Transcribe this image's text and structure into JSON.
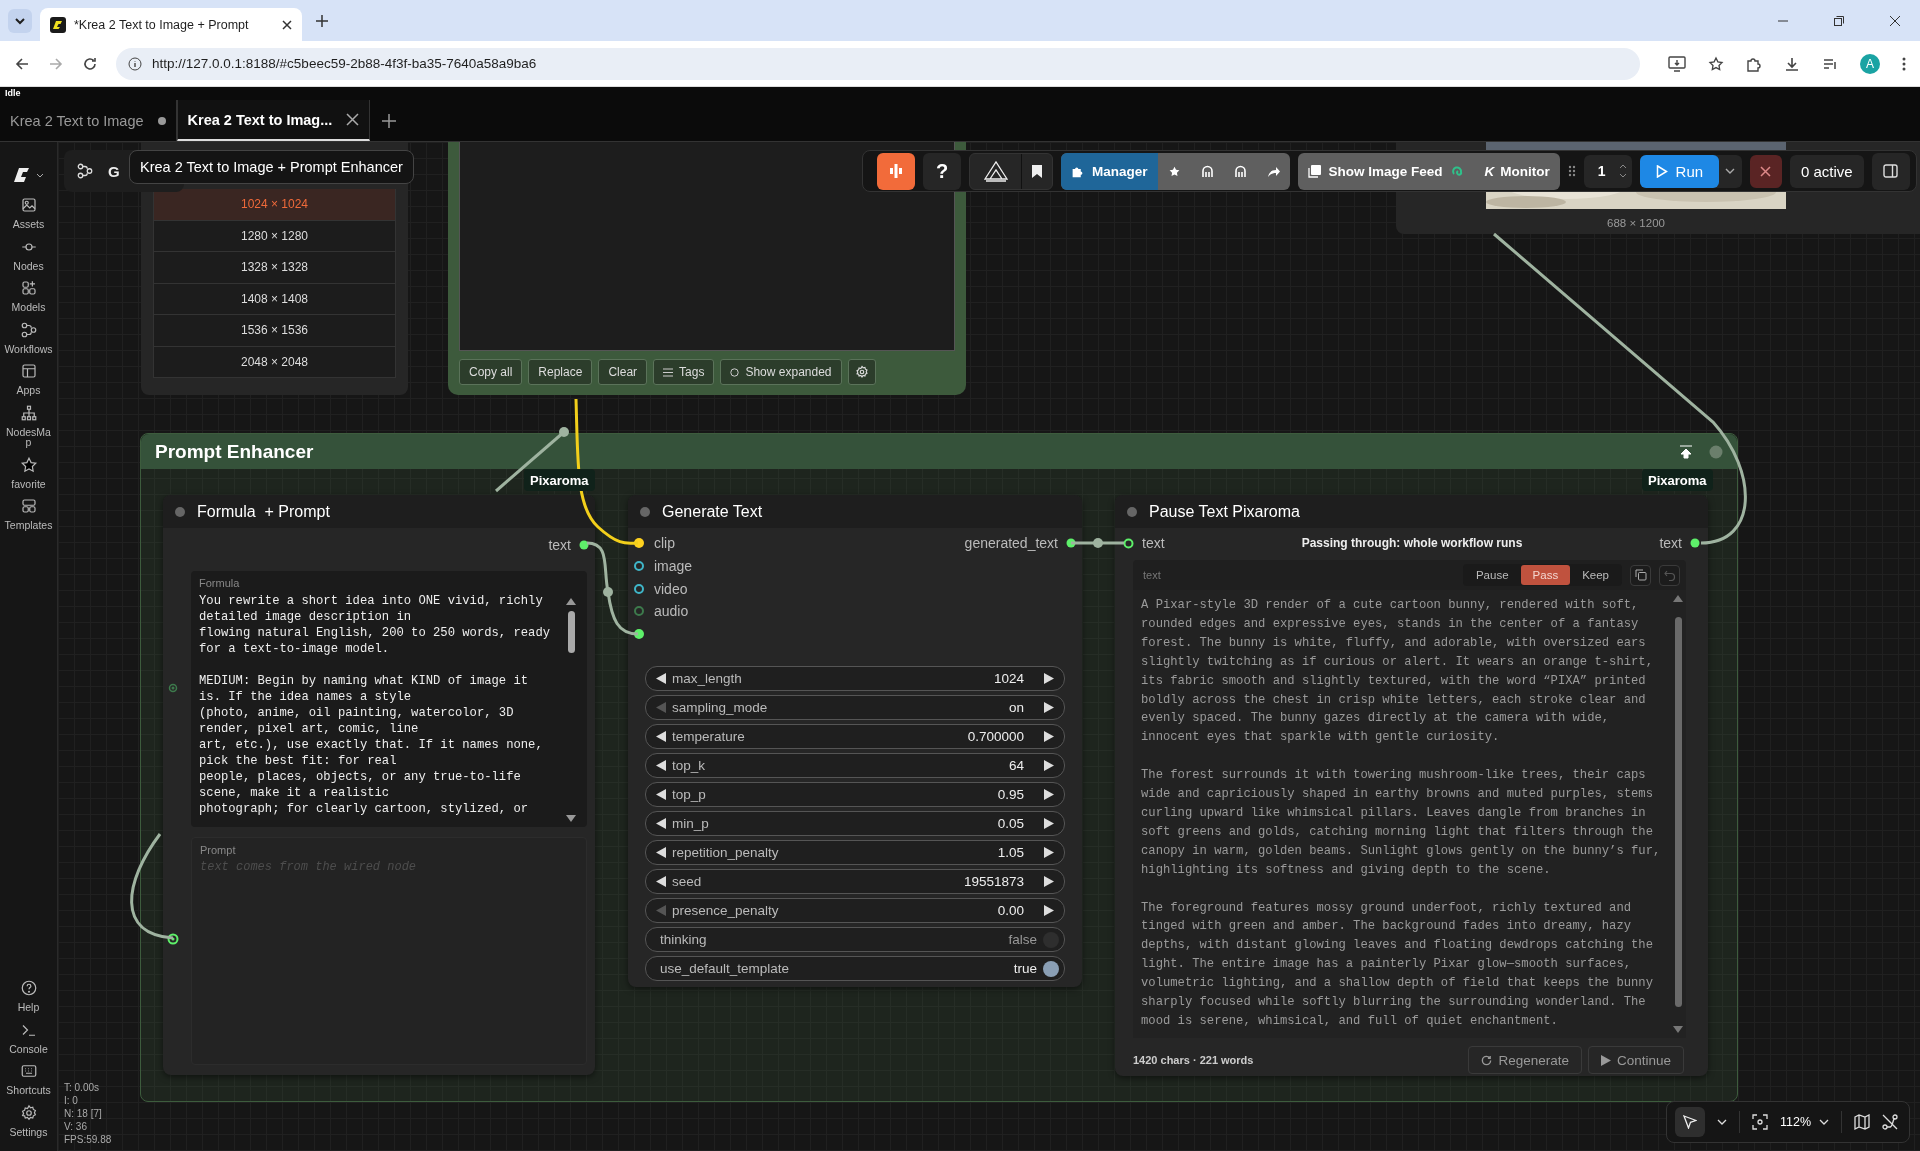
{
  "browser": {
    "tab_title": "*Krea 2 Text to Image + Prompt",
    "url": "http://127.0.0.1:8188/#c5beec59-2b88-4f3f-ba35-7640a58a9ba6",
    "profile_initial": "A"
  },
  "status": "Idle",
  "workflow_tabs": [
    {
      "label": "Krea 2 Text to Image",
      "selected": false,
      "modified": true
    },
    {
      "label": "Krea 2 Text to Imag...",
      "selected": true,
      "modified": false
    }
  ],
  "sidebar": {
    "items": [
      {
        "label": "Assets"
      },
      {
        "label": "Nodes"
      },
      {
        "label": "Models"
      },
      {
        "label": "Workflows"
      },
      {
        "label": "Apps"
      },
      {
        "label": "NodesMap"
      },
      {
        "label": "favorite"
      },
      {
        "label": "Templates"
      }
    ],
    "bottom_items": [
      {
        "label": "Help"
      },
      {
        "label": "Console"
      },
      {
        "label": "Shortcuts"
      },
      {
        "label": "Settings"
      }
    ]
  },
  "graph_bar": {
    "label": "G"
  },
  "tooltip": "Krea 2 Text to Image + Prompt Enhancer",
  "size_list": {
    "options": [
      {
        "label": "1024 × 1024",
        "selected": true
      },
      {
        "label": "1280 × 1280",
        "selected": false
      },
      {
        "label": "1328 × 1328",
        "selected": false
      },
      {
        "label": "1408 × 1408",
        "selected": false
      },
      {
        "label": "1536 × 1536",
        "selected": false
      },
      {
        "label": "2048 × 2048",
        "selected": false
      }
    ]
  },
  "text_node": {
    "buttons": [
      {
        "label": "Copy all",
        "kind": "plain"
      },
      {
        "label": "Replace",
        "kind": "plain"
      },
      {
        "label": "Clear",
        "kind": "plain"
      },
      {
        "label": "Tags",
        "kind": "tags"
      },
      {
        "label": "Show expanded",
        "kind": "toggle"
      }
    ]
  },
  "toolbar": {
    "help": "?",
    "manager": "Manager",
    "image_feed": "Show Image Feed",
    "monitor_mark": "K",
    "monitor": "Monitor",
    "batch_count": "1",
    "run": "Run",
    "active": "0 active"
  },
  "image_preview": {
    "caption": "688 × 1200"
  },
  "group": {
    "title": "Prompt Enhancer",
    "badges": [
      "Pixaroma",
      "Pixaroma"
    ]
  },
  "formula_node": {
    "title": "Formula  + Prompt",
    "output": "text",
    "formula_label": "Formula",
    "formula_text": "You rewrite a short idea into ONE vivid, richly detailed image description in\nflowing natural English, 200 to 250 words, ready for a text-to-image model.\n\nMEDIUM: Begin by naming what KIND of image it is. If the idea names a style\n(photo, anime, oil painting, watercolor, 3D render, pixel art, comic, line\nart, etc.), use exactly that. If it names none, pick the best fit: for real\npeople, places, objects, or any true-to-life scene, make it a realistic\nphotograph; for clearly cartoon, stylized, or",
    "prompt_label": "Prompt",
    "prompt_placeholder": "text comes from the wired node"
  },
  "generate_node": {
    "title": "Generate Text",
    "output": "generated_text",
    "inputs": [
      {
        "label": "clip",
        "color": "#ffd21f",
        "connected": true
      },
      {
        "label": "image",
        "color": "#3fb6c9",
        "connected": false
      },
      {
        "label": "video",
        "color": "#3fb6c9",
        "connected": false
      },
      {
        "label": "audio",
        "color": "#3d7a4c",
        "connected": false
      },
      {
        "color": "#5ef06a",
        "connected": true
      }
    ],
    "widgets": [
      {
        "kind": "number",
        "label": "max_length",
        "value": "1024",
        "left_disabled": false
      },
      {
        "kind": "number",
        "label": "sampling_mode",
        "value": "on",
        "left_disabled": true
      },
      {
        "kind": "number",
        "label": "temperature",
        "value": "0.700000",
        "left_disabled": false
      },
      {
        "kind": "number",
        "label": "top_k",
        "value": "64",
        "left_disabled": false
      },
      {
        "kind": "number",
        "label": "top_p",
        "value": "0.95",
        "left_disabled": false
      },
      {
        "kind": "number",
        "label": "min_p",
        "value": "0.05",
        "left_disabled": false
      },
      {
        "kind": "number",
        "label": "repetition_penalty",
        "value": "1.05",
        "left_disabled": false
      },
      {
        "kind": "number",
        "label": "seed",
        "value": "19551873",
        "left_disabled": false
      },
      {
        "kind": "number",
        "label": "presence_penalty",
        "value": "0.00",
        "left_disabled": true
      },
      {
        "kind": "toggle",
        "label": "thinking",
        "value": "false",
        "on": false
      },
      {
        "kind": "toggle",
        "label": "use_default_template",
        "value": "true",
        "on": true
      }
    ]
  },
  "pause_node": {
    "title": "Pause Text Pixaroma",
    "input": "text",
    "status": "Passing through: whole workflow runs",
    "output": "text",
    "field_label": "text",
    "modes": [
      {
        "label": "Pause",
        "selected": false
      },
      {
        "label": "Pass",
        "selected": true
      },
      {
        "label": "Keep",
        "selected": false
      }
    ],
    "text": "A Pixar-style 3D render of a cute cartoon bunny, rendered with soft, rounded edges and expressive eyes, stands in the center of a fantasy forest. The bunny is white, fluffy, and adorable, with oversized ears slightly twitching as if curious or alert. It wears an orange t-shirt, its fabric smooth and slightly textured, with the word “PIXA” printed boldly across the chest in crisp white letters, each stroke clear and evenly spaced. The bunny gazes directly at the camera with wide, innocent eyes that sparkle with gentle curiosity.\n\nThe forest surrounds it with towering mushroom-like trees, their caps wide and capriciously shaped in earthy browns and muted purples, stems curling upward like whimsical pillars. Leaves dangle from branches in soft greens and golds, catching morning light that filters through the canopy in warm, golden beams. Sunlight glows gently on the bunny’s fur, highlighting its softness and giving depth to the scene.\n\nThe foreground features mossy ground underfoot, richly textured and tinged with green and amber. The background fades into dreamy, hazy depths, with distant glowing leaves and floating dewdrops catching the light. The entire image has a painterly Pixar glow—smooth surfaces, volumetric lighting, and a shallow depth of field that keeps the bunny sharply focused while softly blurring the surrounding wonderland. The mood is serene, whimsical, and full of quiet enchantment.",
    "stats": "1420 chars · 221 words",
    "buttons": [
      {
        "label": "Regenerate",
        "kind": "regenerate"
      },
      {
        "label": "Continue",
        "kind": "continue"
      }
    ]
  },
  "perf_stats": [
    "T: 0.00s",
    "I: 0",
    "N: 18 [7]",
    "V: 36",
    "FPS:59.88"
  ],
  "canvas_controls": {
    "zoom": "112%"
  }
}
